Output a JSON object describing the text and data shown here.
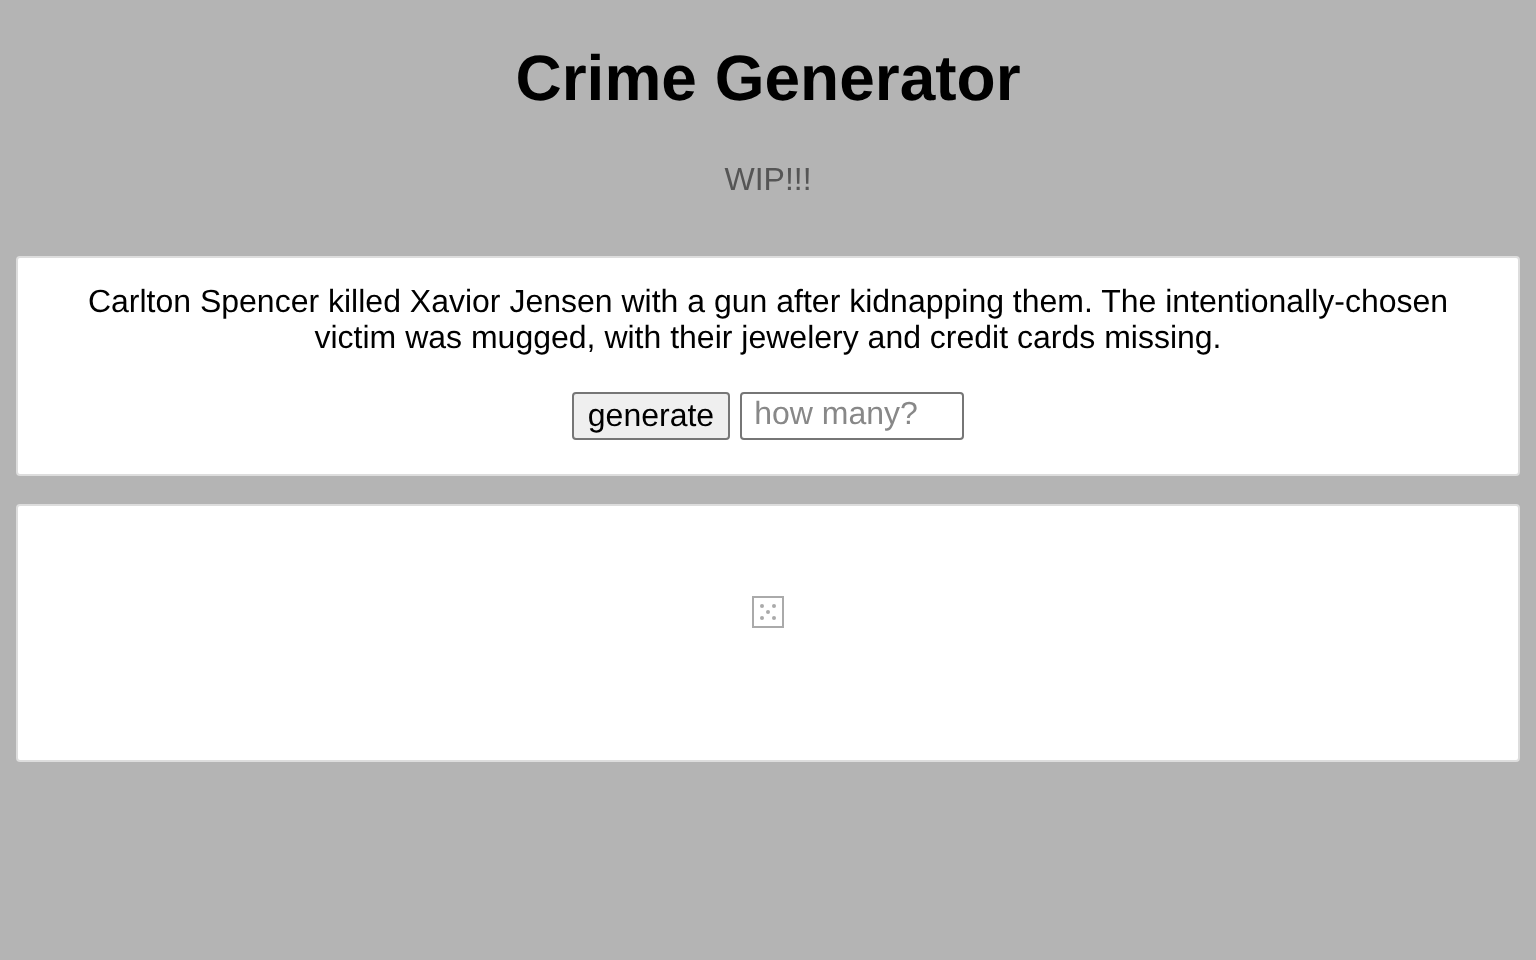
{
  "title": "Crime Generator",
  "subtitle": "WIP!!!",
  "crime": {
    "text": "Carlton Spencer killed Xavior Jensen with a gun after kidnapping them. The intentionally-chosen victim was mugged, with their jewelery and credit cards missing.",
    "button": "generate",
    "count": {
      "placeholder": "how many?"
    }
  }
}
